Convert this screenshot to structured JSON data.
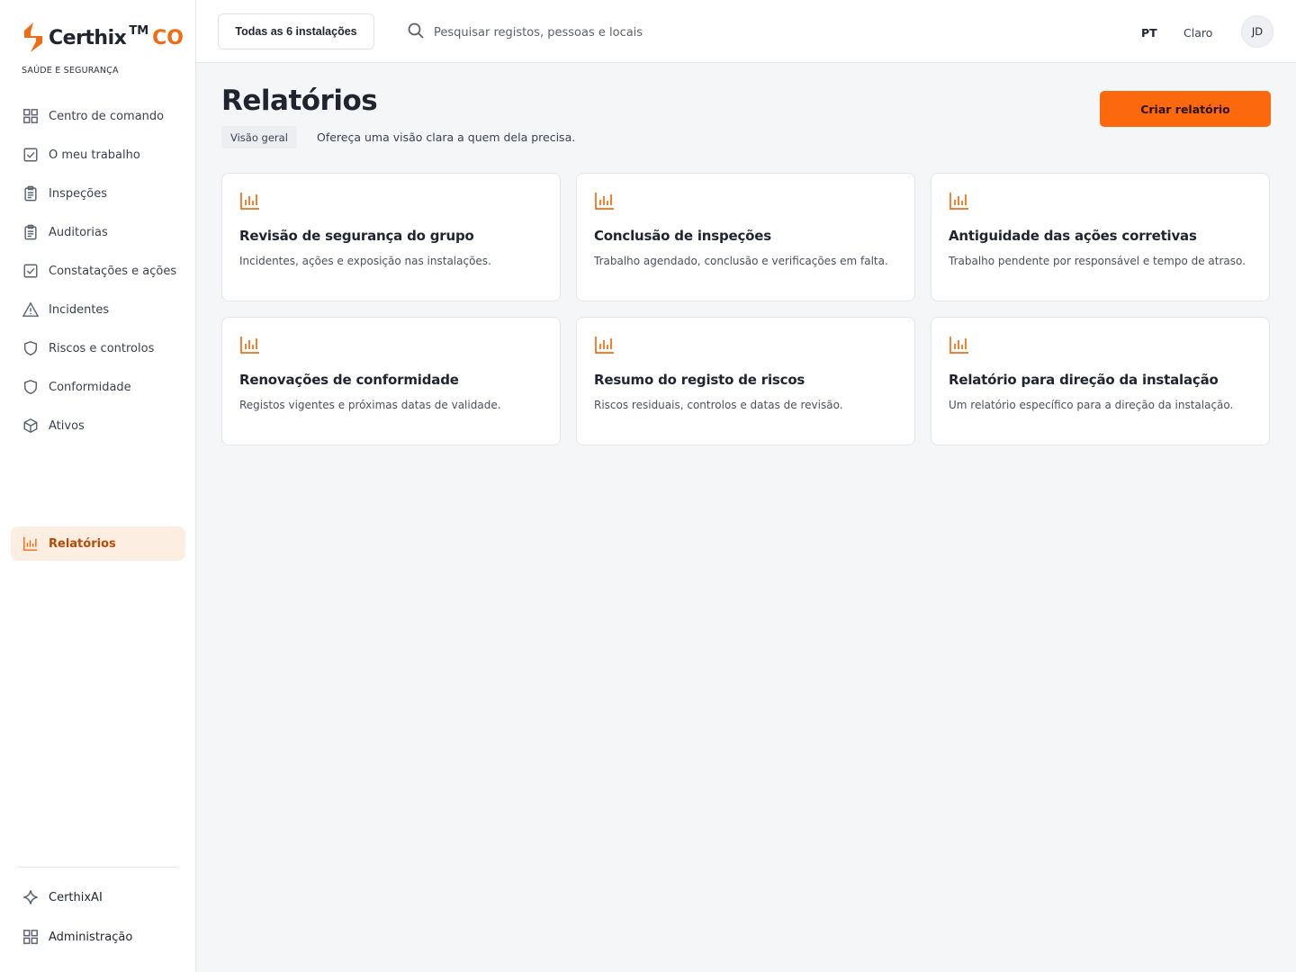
{
  "brand": {
    "name": "Certhix",
    "tm": "TM",
    "suffix": "CO",
    "subtitle": "SAÚDE E SEGURANÇA",
    "accent": "#f26b12"
  },
  "sidebar": {
    "items": [
      {
        "label": "Centro de comando",
        "icon": "grid-icon"
      },
      {
        "label": "O meu trabalho",
        "icon": "check-square-icon"
      },
      {
        "label": "Inspeções",
        "icon": "clipboard-icon"
      },
      {
        "label": "Auditorias",
        "icon": "clipboard-icon"
      },
      {
        "label": "Constatações e ações",
        "icon": "check-square-icon"
      },
      {
        "label": "Incidentes",
        "icon": "warning-triangle-icon"
      },
      {
        "label": "Riscos e controlos",
        "icon": "shield-icon"
      },
      {
        "label": "Conformidade",
        "icon": "shield-icon"
      },
      {
        "label": "Ativos",
        "icon": "cube-icon"
      }
    ],
    "active": {
      "label": "Relatórios",
      "icon": "bar-chart-icon"
    },
    "bottom": [
      {
        "label": "CerthixAI",
        "icon": "sparkle-icon"
      },
      {
        "label": "Administração",
        "icon": "grid-icon"
      }
    ]
  },
  "topbar": {
    "site_selector": "Todas as 6 instalações",
    "search_placeholder": "Pesquisar registos, pessoas e locais",
    "language": "PT",
    "theme": "Claro",
    "avatar_initials": "JD"
  },
  "main": {
    "title": "Relatórios",
    "chip": "Visão geral",
    "subtitle": "Ofereça uma visão clara a quem dela precisa.",
    "create_label": "Criar relatório",
    "create_color": "#fc680d",
    "cards": [
      {
        "title": "Revisão de segurança do grupo",
        "desc": "Incidentes, ações e exposição nas instalações.",
        "icon": "bar-chart-icon"
      },
      {
        "title": "Conclusão de inspeções",
        "desc": "Trabalho agendado, conclusão e verificações em falta.",
        "icon": "bar-chart-icon"
      },
      {
        "title": "Antiguidade das ações corretivas",
        "desc": "Trabalho pendente por responsável e tempo de atraso.",
        "icon": "bar-chart-icon"
      },
      {
        "title": "Renovações de conformidade",
        "desc": "Registos vigentes e próximas datas de validade.",
        "icon": "bar-chart-icon"
      },
      {
        "title": "Resumo do registo de riscos",
        "desc": "Riscos residuais, controlos e datas de revisão.",
        "icon": "bar-chart-icon"
      },
      {
        "title": "Relatório para direção da instalação",
        "desc": "Um relatório específico para a direção da instalação.",
        "icon": "bar-chart-icon"
      }
    ]
  }
}
